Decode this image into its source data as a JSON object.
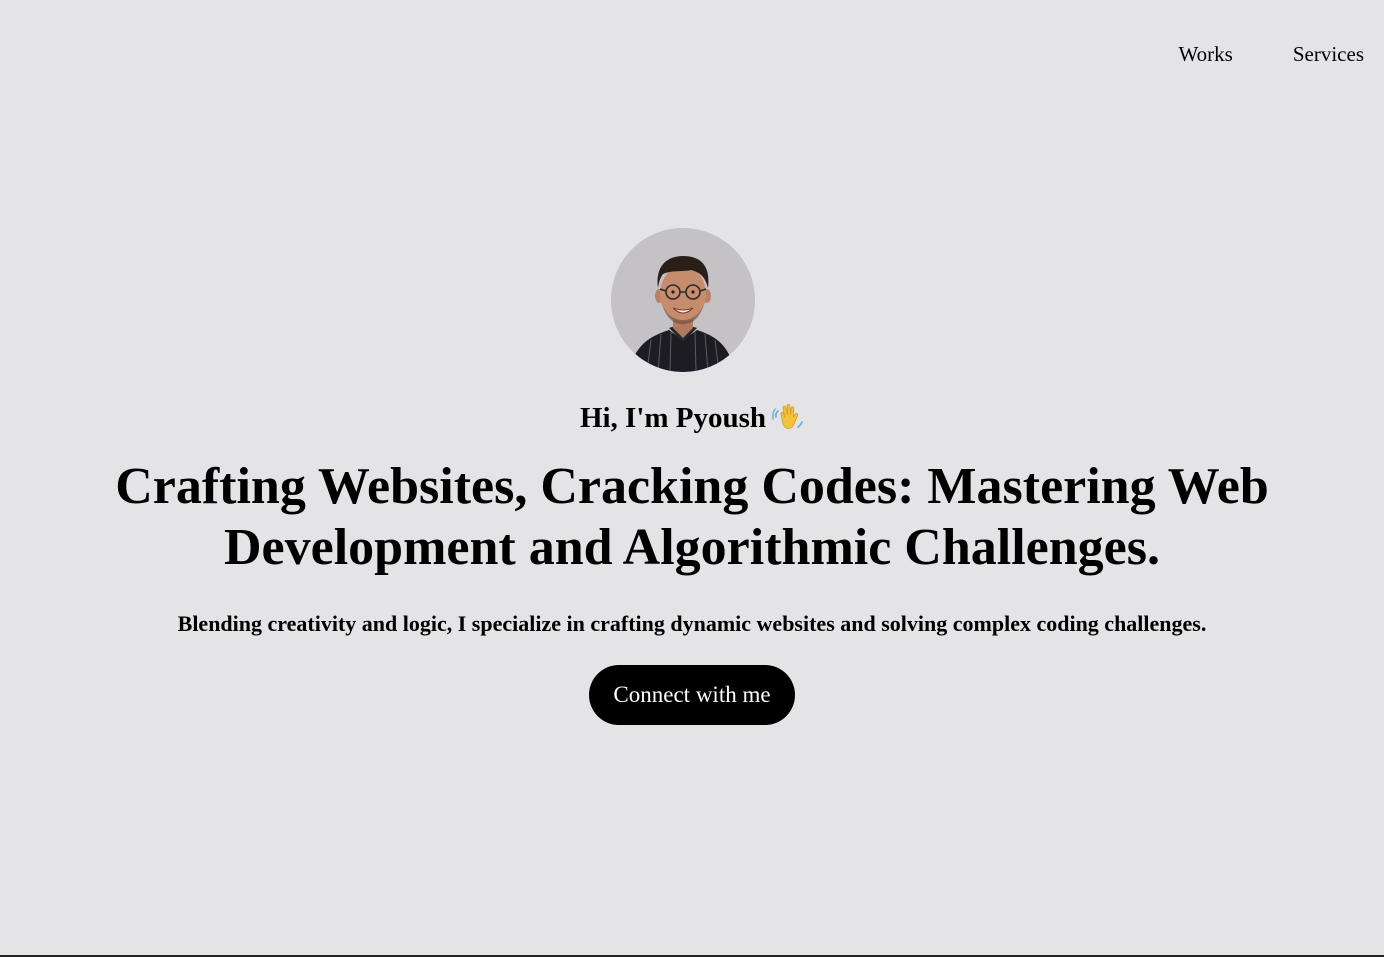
{
  "nav": {
    "items": [
      {
        "label": "Works"
      },
      {
        "label": "Services"
      }
    ]
  },
  "hero": {
    "greeting": "Hi, I'm Pyoush",
    "greeting_icon": "waving-hand-icon",
    "headline": "Crafting Websites, Cracking Codes: Mastering Web Development and Algorithmic Challenges.",
    "subtitle": "Blending creativity and logic, I specialize in crafting dynamic websites and solving complex coding challenges.",
    "cta_label": "Connect with me"
  },
  "colors": {
    "background": "#e4e4e6",
    "avatar_background": "#c5c2c5",
    "button_background": "#000000",
    "button_text": "#ffffff"
  }
}
